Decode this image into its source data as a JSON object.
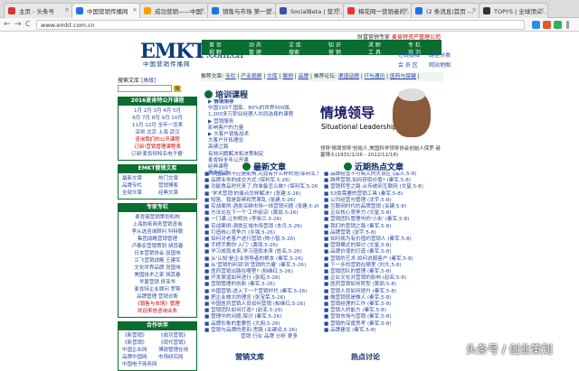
{
  "tabs": [
    {
      "label": "主页 - 头条号",
      "color": "#d33"
    },
    {
      "label": "中国营销传播网",
      "color": "#1a73e8"
    },
    {
      "label": "成功营销——中国..",
      "color": "#f6a000"
    },
    {
      "label": "销售与市场 第一营..",
      "color": "#1a73e8"
    },
    {
      "label": "SocialBeta | 营方..",
      "color": "#35a"
    },
    {
      "label": "梅花网一营销者的..",
      "color": "#e33"
    },
    {
      "label": "(2 条消息)首页 -..",
      "color": "#1a73e8"
    },
    {
      "label": "TOPYS | 全球顶尖..",
      "color": "#333"
    }
  ],
  "address": {
    "url": "www.emkt.com.cn",
    "back": "←",
    "forward": "→",
    "reload": "C"
  },
  "site": {
    "logo": "EMKT",
    "logo_com": ".com.cn",
    "subtitle": "中国营销传播网",
    "top_right": "财富营销专家",
    "top_right_red": "麦肯特资产管理公司",
    "nav1": [
      "首 页",
      "动 态",
      "文 库",
      "知 识",
      "求 职",
      "专 栏"
    ],
    "nav2": [
      "视 野",
      "管 理",
      "搜索",
      "营 销",
      "工 具",
      "培 训"
    ],
    "rlinks": [
      "在线投稿",
      "路径分类",
      "会 员 区",
      "网站地图"
    ]
  },
  "sidebar": {
    "search_label": "搜索文库",
    "search_btn": "[高级]",
    "search_go": "搜",
    "course_title": "2016麦肯特公开课程",
    "course_lines": [
      "1月 2月 3月 4月 5月",
      "6月 7月 8月 9月 10月",
      "11月 12月 全年一览表",
      "深圳 北京 上海 武汉"
    ],
    "course_red": [
      "咨询我们的公开课程",
      "订阅!营销管理课程表"
    ],
    "course_last": "订阅'麦肯特知名电子报'",
    "emkt_title": "EMKT营销文库",
    "emkt_items": [
      "最新文章",
      "热门文章",
      "品牌专栏",
      "营销博客",
      "全部文章",
      "经典文章"
    ],
    "rec_title": "专家专栏",
    "rec_lines": [
      "麦肯锡营销策划机构",
      "上海励拓商务营销咨询",
      "李从选咨询顾问 科特勒",
      "集团战略营销管理",
      "卢泰宏营销策划 胡其春",
      "日本营销协会 张国伟",
      "兰飞营销战略 王建军",
      "文化世界品牌 张国伟",
      "美国技术之家 胡其春",
      "华夏营销 佟亚华",
      "麦肯特企业顾问 罗斯",
      "品牌管理 营销诊断"
    ],
    "rec_red": "《销售与市场》管理",
    "rec_red2": "欢迎来信咨询业务",
    "partner_title": "合作伙伴",
    "partners": [
      "《新营销》",
      "《成功营销》",
      "《新营销》",
      "《现代营销》",
      "中国企业网",
      "博锐管理在线",
      "品牌中国网",
      "市场研究网",
      "中国电子商务网"
    ]
  },
  "recommend": {
    "label": "推荐文章:",
    "links": [
      "专栏",
      "产业观察",
      "文库",
      "案例",
      "品牌"
    ],
    "mid": "推荐论坛:",
    "links2": [
      "渠道话题",
      "IT与通讯",
      "医药与保健"
    ]
  },
  "training": {
    "head": "培训课程",
    "items": [
      "情境领导",
      "中国150个国家、80%的世界500强、",
      "1,200多万职业经理人共同选择的课程",
      "营销服务",
      "影响客户的力量",
      "大客户销售战术",
      "大客户开拓理念",
      "高绩之路",
      "有效问题解决和决策制定",
      "麦肯特全年公开课",
      "经典课程",
      "更多培训"
    ]
  },
  "banner": {
    "title": "情境领导",
    "sub": "Situational Leadership",
    "caption": "领导'情境领导'创始人,美国科学领导协会创始人保罗·赫塞博士(1931/1/26 - 2012/12/18)"
  },
  "latest": {
    "head": "最新文章",
    "items": [
      "中国品牌不应是配角,究竟有什么样的竞(保利军,5-26)",
      "品牌业务的成交方式 (保利军,5-26)",
      "功能食品时代来了,你准备怎么做? (保利军,5-26)",
      "'学术营销'的痛点怎样解决? (张建,5-26)",
      "短笛、我是郭莽和荒寒乱 (张建,5-26)",
      "实战案例:酒类深耕市场一线营销问题 (张建,5-26)",
      "方法论在下一个'工作前沿' (黄丽,5-26)",
      "一门课,让你明白 (李晓兰,5-26)",
      "实战案例:酒类区域市场营销 (本月,5-26)",
      "打造核心竞争力 (许强,5-26)",
      "如何对老客户进行营销 (陈小智,5-26)",
      "手把手教你'入门' (黄丽,5-26)",
      "学习成就未来,学习造就未来 (姓名,5-26)",
      "从'认知'是企业领导者的根本 (秦军,5-26)",
      "从'营销的利润'到'营销的力量' (秦军,5-26)",
      "医药营销出路在哪里? (柏继红,5-26)",
      "开发渠道如何进行 (张昭,5-26)",
      "营销管理的创新 (秦军,5-26)",
      "中国营销:进入下一个营销时代 (秦军,5-26)",
      "把企业做大的理念 (张宝荣,5-26)",
      "中国医药营销人员如何营销 (柏继红,5-26)",
      "营销团队如何打造? (赵亚,5-26)",
      "管理中的问题,探讨 (秦军,5-26)",
      "品牌形象的重要性 (大胡,5-26)",
      "营销与品牌的差别:思路 (关键词,5-26)"
    ],
    "footer": [
      "营销",
      "行业",
      "品牌",
      "分析",
      "更多"
    ]
  },
  "hot": {
    "head": "近期热点文章",
    "items": [
      "品牌经营不可陷入的大误区 (品人,5-8)",
      "跨界营销,如何获取价值? (秦军,5-8)",
      "营销转型之路:从传统到互联网 (文星,5-8)",
      "53类需要的营销工具 (秦军,5-8)",
      "公司经营与管理 (沈宇,5-8)",
      "互联网时代的品牌营销 (关键,5-8)",
      "企业核心竞争力 (文星,5-8)",
      "营销团队管理中的'小米' (秦军,5-8)",
      "我们的营销之路 (秦军,5-8)",
      "品牌营销 (张宇,5-8)",
      "如何成为有价值的营销人 (秦军,5-8)",
      "营销模式的探讨 (文星,5-8)",
      "品牌价值的打造 (秦军,5-8)",
      "营销的艺术:如何说服客户 (秦军,5-8)",
      "下一步的营销在哪里 (刘大,5-8)",
      "营销团队的管理 (秦军,5-8)",
      "企业文化对营销的影响 (赵亚,5-8)",
      "医药营销如何转型 (黄丽,5-8)",
      "营销人员如何提升 (秦军,5-8)",
      "做营销就是做人 (秦军,5-8)",
      "营销经理的工作 (秦军,5-8)",
      "营销人的能力 (秦军,5-8)",
      "营销市场与营销 (秦军,5-8)",
      "营销的深度思考 (秦军,5-8)",
      "品牌建设 (秦军,5-8)"
    ]
  },
  "bottom": {
    "left": "营销文库",
    "right": "热点讨论"
  },
  "watermark": "头条号 / 创业策划"
}
